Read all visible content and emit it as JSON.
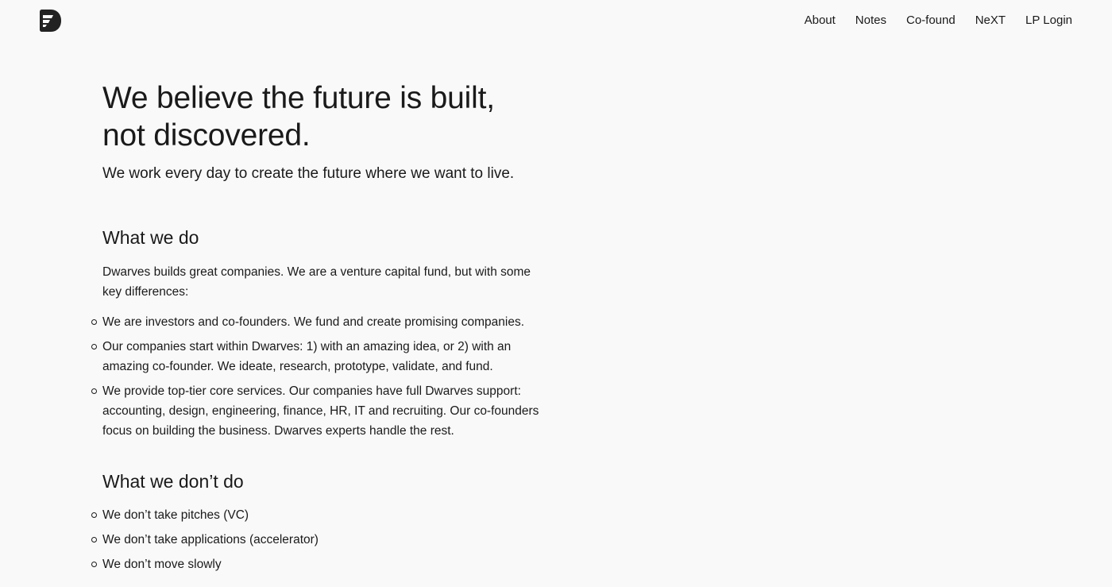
{
  "header": {
    "logo_icon": "dwarves-logo-icon",
    "nav": [
      "About",
      "Notes",
      "Co-found",
      "NeXT",
      "LP Login"
    ]
  },
  "hero": {
    "title_line1": "We believe the future is built,",
    "title_line2": "not discovered.",
    "tagline": "We work every day to create the future where we want to live."
  },
  "what_we_do": {
    "heading": "What we do",
    "intro": "Dwarves builds great companies. We are a venture capital fund, but with some key differences:",
    "items": [
      "We are investors and co-founders. We fund and create promising companies.",
      "Our companies start within Dwarves: 1) with an amazing idea, or 2) with an amazing co-founder. We ideate, research, prototype, validate, and fund.",
      "We provide top-tier core services. Our companies have full Dwarves support: accounting, design, engineering, finance, HR, IT and recruiting. Our co-founders focus on building the business. Dwarves experts handle the rest."
    ]
  },
  "what_we_dont_do": {
    "heading": "What we don’t do",
    "items": [
      "We don’t take pitches (VC)",
      "We don’t take applications (accelerator)",
      "We don’t move slowly"
    ]
  },
  "colors": {
    "background": "#f9f9f9",
    "text": "#1a1a1a",
    "logo": "#222222"
  }
}
